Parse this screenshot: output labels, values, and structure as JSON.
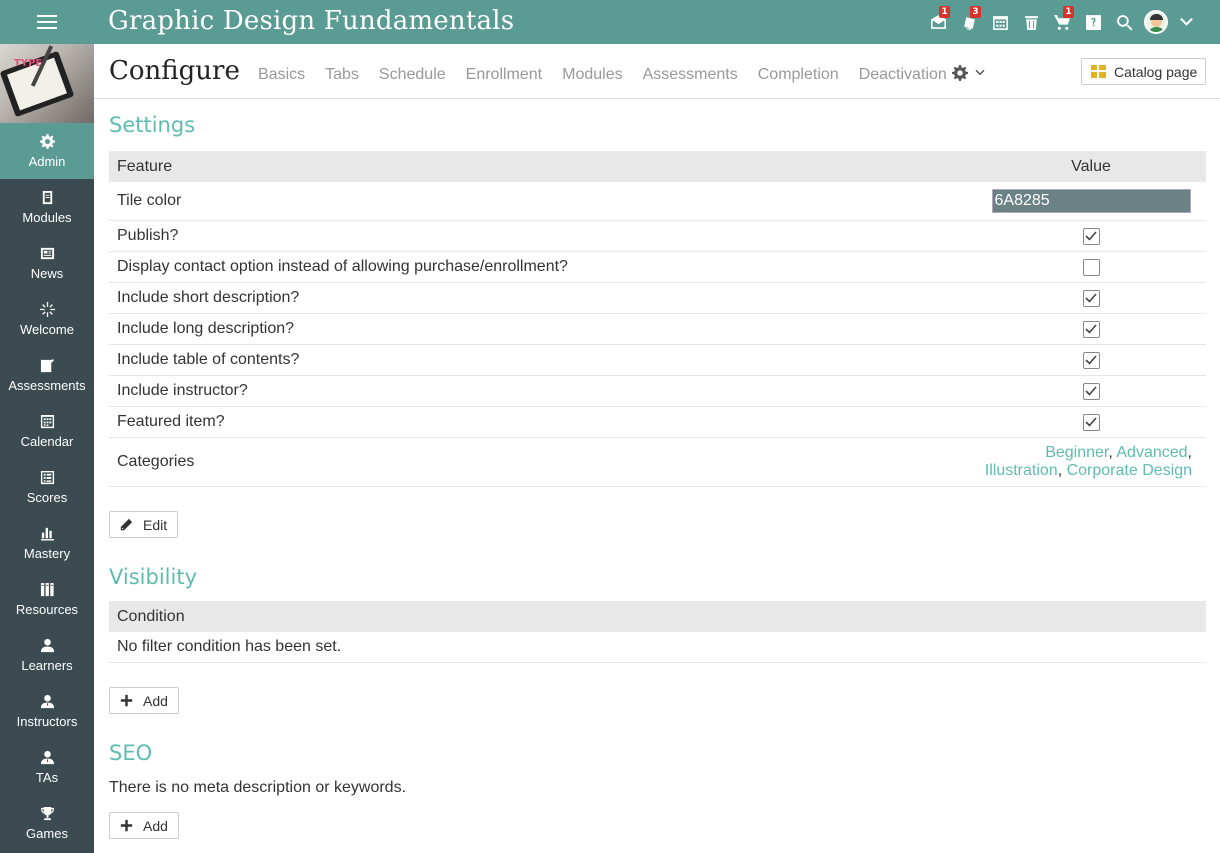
{
  "app": {
    "title": "Graphic Design Fundamentals"
  },
  "topbar": {
    "badges": {
      "messages": "1",
      "notifications": "3",
      "cart": "1"
    },
    "icons": [
      "hamburger-icon",
      "envelope-icon",
      "bell-icon",
      "calendar-icon",
      "trash-icon",
      "cart-icon",
      "help-icon",
      "search-icon",
      "avatar",
      "chevron-down-icon"
    ]
  },
  "sidebar": {
    "items": [
      {
        "label": "Admin",
        "icon": "gear-icon",
        "active": true
      },
      {
        "label": "Modules",
        "icon": "book-icon"
      },
      {
        "label": "News",
        "icon": "newspaper-icon"
      },
      {
        "label": "Welcome",
        "icon": "sparkle-icon"
      },
      {
        "label": "Assessments",
        "icon": "checklist-icon"
      },
      {
        "label": "Calendar",
        "icon": "calendar-icon"
      },
      {
        "label": "Scores",
        "icon": "scores-icon"
      },
      {
        "label": "Mastery",
        "icon": "bar-chart-icon"
      },
      {
        "label": "Resources",
        "icon": "books-icon"
      },
      {
        "label": "Learners",
        "icon": "person-icon"
      },
      {
        "label": "Instructors",
        "icon": "instructor-icon"
      },
      {
        "label": "TAs",
        "icon": "ta-icon"
      },
      {
        "label": "Games",
        "icon": "trophy-icon"
      }
    ]
  },
  "header": {
    "title": "Configure",
    "tabs": [
      "Basics",
      "Tabs",
      "Schedule",
      "Enrollment",
      "Modules",
      "Assessments",
      "Completion",
      "Deactivation"
    ],
    "catalog_button": "Catalog page"
  },
  "settings": {
    "title": "Settings",
    "col_feature": "Feature",
    "col_value": "Value",
    "tile_color_label": "Tile color",
    "tile_color_value": "6A8285",
    "rows": [
      {
        "label": "Publish?",
        "checked": true
      },
      {
        "label": "Display contact option instead of allowing purchase/enrollment?",
        "checked": false
      },
      {
        "label": "Include short description?",
        "checked": true
      },
      {
        "label": "Include long description?",
        "checked": true
      },
      {
        "label": "Include table of contents?",
        "checked": true
      },
      {
        "label": "Include instructor?",
        "checked": true
      },
      {
        "label": "Featured item?",
        "checked": true
      }
    ],
    "categories_label": "Categories",
    "categories": [
      "Beginner",
      "Advanced",
      "Illustration",
      "Corporate Design"
    ],
    "edit_button": "Edit"
  },
  "visibility": {
    "title": "Visibility",
    "col_condition": "Condition",
    "empty_text": "No filter condition has been set.",
    "add_button": "Add"
  },
  "seo": {
    "title": "SEO",
    "empty_text": "There is no meta description or keywords.",
    "add_button": "Add"
  },
  "colors": {
    "topbar": "#5a9b93",
    "sidebar": "#3c4a52",
    "accent": "#5fbcb1",
    "badge": "#d9322c"
  }
}
